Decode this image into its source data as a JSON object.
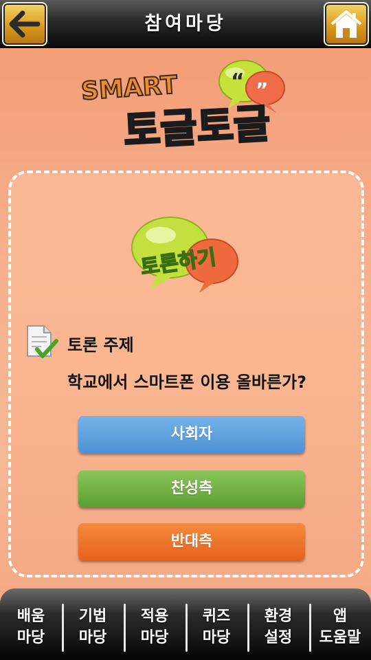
{
  "header": {
    "title": "참여마당",
    "back_icon": "arrow-left-icon",
    "home_icon": "home-icon"
  },
  "logo": {
    "smart_text": "SMART",
    "title_text": "토글토글"
  },
  "badge": {
    "text": "토론하기"
  },
  "topic": {
    "label": "토론 주제",
    "text": "학교에서 스마트폰 이용 올바른가?"
  },
  "roles": {
    "moderator": "사회자",
    "pro": "찬성측",
    "con": "반대측"
  },
  "nav": [
    {
      "line1": "배움",
      "line2": "마당"
    },
    {
      "line1": "기법",
      "line2": "마당"
    },
    {
      "line1": "적용",
      "line2": "마당"
    },
    {
      "line1": "퀴즈",
      "line2": "마당"
    },
    {
      "line1": "환경",
      "line2": "설정"
    },
    {
      "line1": "앱",
      "line2": "도움말"
    }
  ],
  "colors": {
    "background": "#f6b08d",
    "moderator_button": "#5a9be0",
    "pro_button": "#6bad3e",
    "con_button": "#ec7228",
    "header": "#1a1a1a"
  }
}
